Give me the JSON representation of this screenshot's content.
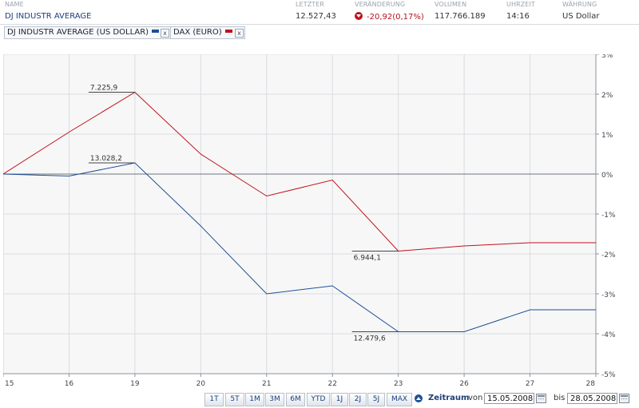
{
  "header": {
    "labels": {
      "name": "NAME",
      "last": "LETZTER",
      "change": "VERÄNDERUNG",
      "volume": "VOLUMEN",
      "time": "UHRZEIT",
      "currency": "WÄHRUNG"
    },
    "values": {
      "name": "DJ INDUSTR AVERAGE",
      "last": "12.527,43",
      "change": "-20,92(0,17%)",
      "volume": "117.766.189",
      "time": "14:16",
      "currency": "US Dollar"
    }
  },
  "legend": [
    {
      "label": "DJ INDUSTR AVERAGE (US DOLLAR)",
      "color": "#1d4f94",
      "close": "x"
    },
    {
      "label": "DAX (EURO)",
      "color": "#c0121c",
      "close": "x"
    }
  ],
  "colors": {
    "dj": "#1d4f94",
    "dax": "#c0121c",
    "grid": "#d9dde2",
    "plot_bg": "#f7f7f7"
  },
  "chart_data": {
    "type": "line",
    "categories": [
      "15",
      "16",
      "19",
      "20",
      "21",
      "22",
      "23",
      "26",
      "27",
      "28"
    ],
    "series": [
      {
        "name": "DJ INDUSTR AVERAGE (US DOLLAR)",
        "color": "#1d4f94",
        "values": [
          0.0,
          -0.05,
          0.28,
          -1.3,
          -3.0,
          -2.8,
          -3.95,
          -3.95,
          -3.4,
          -3.4
        ]
      },
      {
        "name": "DAX (EURO)",
        "color": "#c0121c",
        "values": [
          0.0,
          1.05,
          2.05,
          0.5,
          -0.55,
          -0.15,
          -1.93,
          -1.8,
          -1.72,
          -1.72
        ]
      }
    ],
    "y_ticks": [
      "3%",
      "2%",
      "1%",
      "0%",
      "-1%",
      "-2%",
      "-3%",
      "-4%",
      "-5%"
    ],
    "ylim": [
      -5,
      3
    ],
    "annotations": [
      {
        "text": "7.225,9",
        "series": "DAX (EURO)",
        "category": "19"
      },
      {
        "text": "13.028,2",
        "series": "DJ INDUSTR AVERAGE (US DOLLAR)",
        "category": "19"
      },
      {
        "text": "6.944,1",
        "series": "DAX (EURO)",
        "category": "23"
      },
      {
        "text": "12.479,6",
        "series": "DJ INDUSTR AVERAGE (US DOLLAR)",
        "category": "23"
      }
    ],
    "grid": true,
    "legend": "top-left"
  },
  "toolbar": {
    "buttons": [
      "1T",
      "5T",
      "1M",
      "3M",
      "6M",
      "YTD",
      "1J",
      "2J",
      "5J",
      "MAX"
    ],
    "range_label": "Zeitraum",
    "from_label": "von",
    "from_date": "15.05.2008",
    "to_label": "bis",
    "to_date": "28.05.2008"
  }
}
